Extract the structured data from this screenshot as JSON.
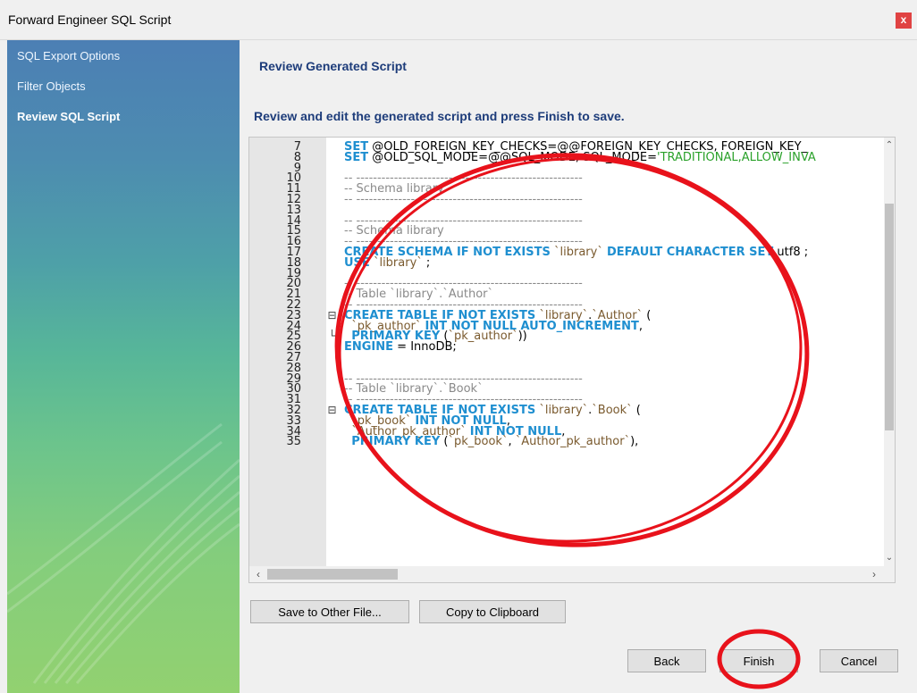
{
  "window": {
    "title": "Forward Engineer SQL Script",
    "close_label": "x"
  },
  "sidebar": {
    "items": [
      {
        "label": "SQL Export Options",
        "active": false
      },
      {
        "label": "Filter Objects",
        "active": false
      },
      {
        "label": "Review SQL Script",
        "active": true
      }
    ]
  },
  "main": {
    "heading": "Review Generated Script",
    "subheading": "Review and edit the generated script and press Finish to save."
  },
  "editor": {
    "lines": [
      {
        "n": "7",
        "text": "SET @OLD_FOREIGN_KEY_CHECKS=@@FOREIGN_KEY_CHECKS, FOREIGN_KEY_"
      },
      {
        "n": "8",
        "text": "SET @OLD_SQL_MODE=@@SQL_MODE, SQL_MODE='TRADITIONAL,ALLOW_INVA"
      },
      {
        "n": "9",
        "text": ""
      },
      {
        "n": "10",
        "text": "-- ------------------------------------------------------"
      },
      {
        "n": "11",
        "text": "-- Schema library"
      },
      {
        "n": "12",
        "text": "-- ------------------------------------------------------"
      },
      {
        "n": "13",
        "text": ""
      },
      {
        "n": "14",
        "text": "-- ------------------------------------------------------"
      },
      {
        "n": "15",
        "text": "-- Schema library"
      },
      {
        "n": "16",
        "text": "-- ------------------------------------------------------"
      },
      {
        "n": "17",
        "text": "CREATE SCHEMA IF NOT EXISTS `library` DEFAULT CHARACTER SET utf8 ;"
      },
      {
        "n": "18",
        "text": "USE `library` ;"
      },
      {
        "n": "19",
        "text": ""
      },
      {
        "n": "20",
        "text": "-- ------------------------------------------------------"
      },
      {
        "n": "21",
        "text": "-- Table `library`.`Author`"
      },
      {
        "n": "22",
        "text": "-- ------------------------------------------------------"
      },
      {
        "n": "23",
        "text": "CREATE TABLE IF NOT EXISTS `library`.`Author` ("
      },
      {
        "n": "24",
        "text": "  `pk_author` INT NOT NULL AUTO_INCREMENT,"
      },
      {
        "n": "25",
        "text": "  PRIMARY KEY (`pk_author`))"
      },
      {
        "n": "26",
        "text": "ENGINE = InnoDB;"
      },
      {
        "n": "27",
        "text": ""
      },
      {
        "n": "28",
        "text": ""
      },
      {
        "n": "29",
        "text": "-- ------------------------------------------------------"
      },
      {
        "n": "30",
        "text": "-- Table `library`.`Book`"
      },
      {
        "n": "31",
        "text": "-- ------------------------------------------------------"
      },
      {
        "n": "32",
        "text": "CREATE TABLE IF NOT EXISTS `library`.`Book` ("
      },
      {
        "n": "33",
        "text": "  `pk_book` INT NOT NULL,"
      },
      {
        "n": "34",
        "text": "  `Author_pk_author` INT NOT NULL,"
      },
      {
        "n": "35",
        "text": "  PRIMARY KEY (`pk_book`, `Author_pk_author`),"
      }
    ]
  },
  "actions": {
    "save_to_file": "Save to Other File...",
    "copy_to_clipboard": "Copy to Clipboard",
    "back": "Back",
    "finish": "Finish",
    "cancel": "Cancel"
  },
  "colors": {
    "heading": "#1d3c7a",
    "keyword": "#1f8fd0",
    "string": "#2aa12a",
    "comment": "#8a8a8a",
    "annotation": "#e8121b"
  }
}
